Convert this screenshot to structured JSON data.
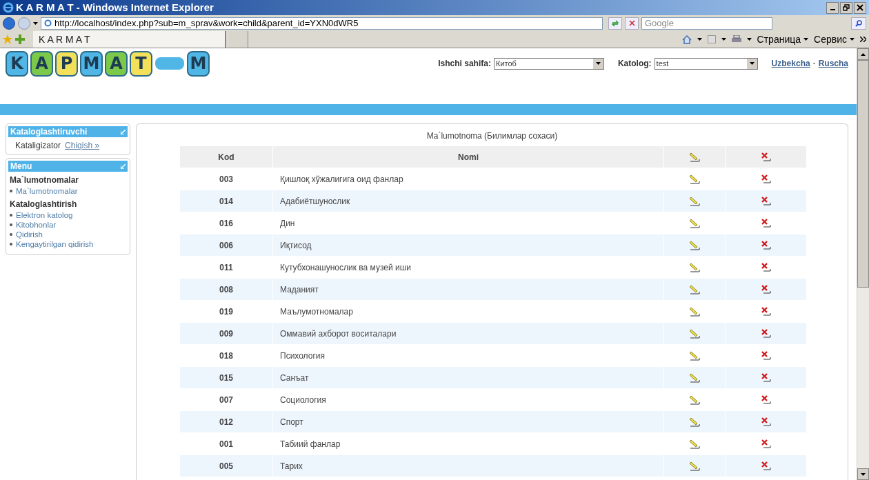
{
  "window": {
    "title": "K A R M A T - Windows Internet Explorer"
  },
  "address_bar": {
    "url": "http://localhost/index.php?sub=m_sprav&work=child&parent_id=YXN0dWR5"
  },
  "search": {
    "placeholder": "Google"
  },
  "tab": {
    "label": "K A R M A T",
    "selected": true
  },
  "command_bar": [
    "Страница",
    "Сервис"
  ],
  "logo": [
    {
      "kind": "letter",
      "text": "K",
      "color": "#4fb6e6"
    },
    {
      "kind": "letter",
      "text": "A",
      "color": "#7cc84a"
    },
    {
      "kind": "letter",
      "text": "P",
      "color": "#f3e05a"
    },
    {
      "kind": "letter",
      "text": "M",
      "color": "#4fb6e6"
    },
    {
      "kind": "letter",
      "text": "A",
      "color": "#7cc84a"
    },
    {
      "kind": "letter",
      "text": "T",
      "color": "#f3e05a"
    },
    {
      "kind": "dash",
      "color": "#4fb6e6"
    },
    {
      "kind": "letter",
      "text": "M",
      "color": "#4fb6e6"
    }
  ],
  "header": {
    "work_label": "Ishchi sahifa:",
    "work_value": "Китоб",
    "catalog_label": "Katolog:",
    "catalog_value": "test",
    "languages": [
      "Uzbekcha",
      "Ruscha"
    ],
    "separator": "·"
  },
  "user_panel": {
    "title": "Kataloglashtiruvchi",
    "user": "Kataligizator",
    "logout": "Chiqish »"
  },
  "menu": {
    "title": "Menu",
    "sections": [
      {
        "heading": "Ma`lumotnomalar",
        "items": [
          "Ma`lumotnomalar"
        ]
      },
      {
        "heading": "Kataloglashtirish",
        "items": [
          "Elektron katolog",
          "Kitobhonlar",
          "Qidirish",
          "Kengaytirilgan qidirish"
        ]
      }
    ]
  },
  "table": {
    "title": "Ma`lumotnoma (Билимлар сохаси)",
    "columns": [
      "Kod",
      "Nomi"
    ],
    "rows": [
      {
        "code": "003",
        "name": "Қишлоқ хўжалигига оид фанлар"
      },
      {
        "code": "014",
        "name": "Адабиётшунослик"
      },
      {
        "code": "016",
        "name": "Дин"
      },
      {
        "code": "006",
        "name": "Иқтисод"
      },
      {
        "code": "011",
        "name": "Кутубхонашунослик ва музей иши"
      },
      {
        "code": "008",
        "name": "Маданият"
      },
      {
        "code": "019",
        "name": "Маълумотномалар"
      },
      {
        "code": "009",
        "name": "Оммавий ахборот воситалари"
      },
      {
        "code": "018",
        "name": "Психология"
      },
      {
        "code": "015",
        "name": "Санъат"
      },
      {
        "code": "007",
        "name": "Социология"
      },
      {
        "code": "012",
        "name": "Спорт"
      },
      {
        "code": "001",
        "name": "Табиий фанлар"
      },
      {
        "code": "005",
        "name": "Тарих"
      }
    ]
  }
}
